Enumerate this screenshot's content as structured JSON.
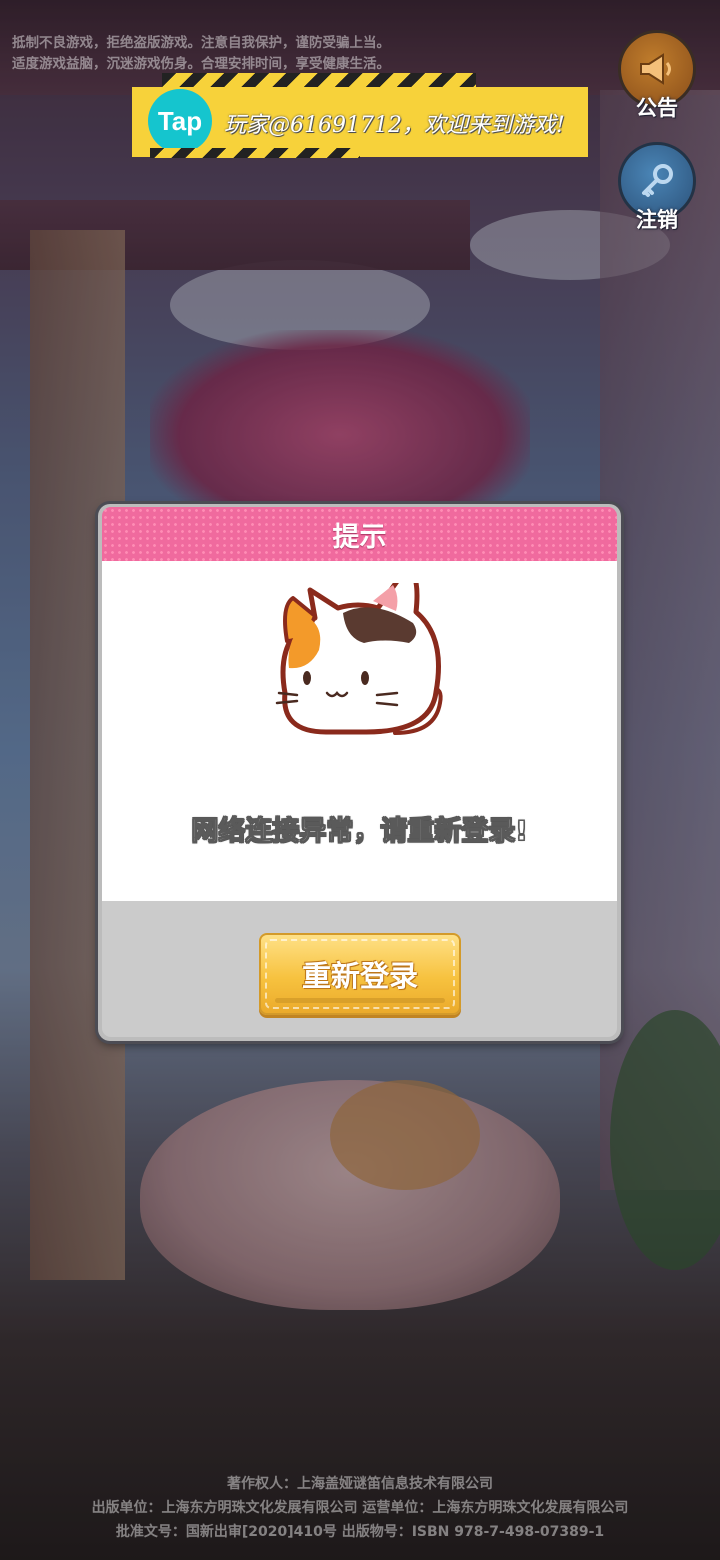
{
  "health_notice": {
    "line1": "抵制不良游戏，拒绝盗版游戏。注意自我保护，谨防受骗上当。",
    "line2": "适度游戏益脑，沉迷游戏伤身。合理安排时间，享受健康生活。"
  },
  "tap_banner": {
    "logo": "Tap",
    "welcome": "玩家@61691712，欢迎来到游戏!"
  },
  "side_buttons": {
    "notice_label": "公告",
    "notice_icon": "megaphone-icon",
    "logout_label": "注销",
    "logout_icon": "key-icon"
  },
  "dialog": {
    "title": "提示",
    "message": "网络连接异常，请重新登录!",
    "button_label": "重新登录"
  },
  "credits": {
    "line1": "著作权人：上海盖娅谜笛信息技术有限公司",
    "line2": "出版单位：上海东方明珠文化发展有限公司   运营单位：上海东方明珠文化发展有限公司",
    "line3": "批准文号：国新出审[2020]410号   出版物号：ISBN 978-7-498-07389-1"
  },
  "colors": {
    "header_pink": "#f06a9e",
    "button_gold": "#f7c23f",
    "banner_yellow": "#f7d23a",
    "tap_teal": "#15c5ce"
  }
}
